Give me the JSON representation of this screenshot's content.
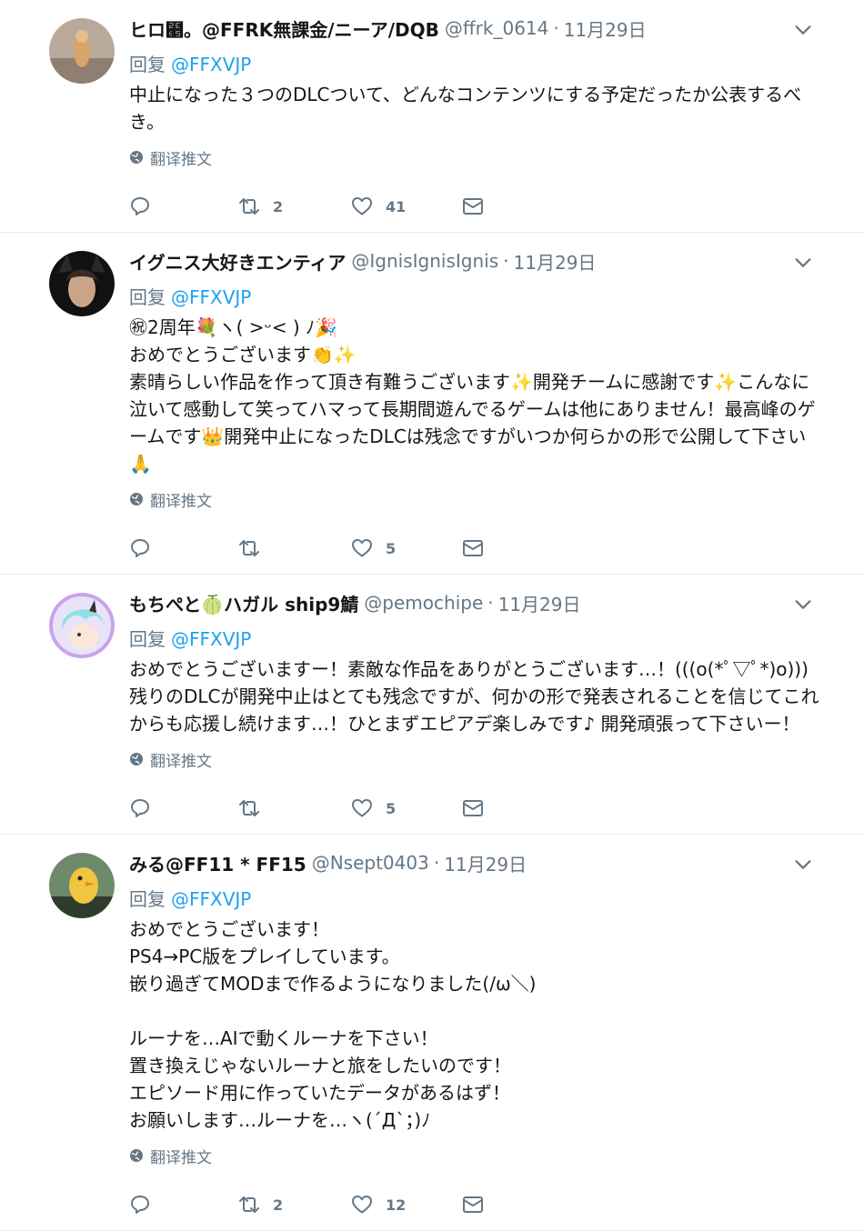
{
  "colors": {
    "link": "#1da1f2",
    "secondary": "#657786",
    "text": "#14171a",
    "divider": "#e6ecf0"
  },
  "icons": {
    "avatar_chevron": "chevron-down-icon",
    "reply": "reply-icon",
    "retweet": "retweet-icon",
    "like": "heart-icon",
    "message": "envelope-icon",
    "translate": "globe-icon"
  },
  "tweets": [
    {
      "name": "ヒロ⹥。@FFRK無課金/ニーア/DQB",
      "handle": "@ffrk_0614",
      "time": "11月29日",
      "reply_label": "回复",
      "reply_mention": "@FFXVJP",
      "text": "中止になった３つのDLCついて、どんなコンテンツにする予定だったか公表するべき。",
      "translate": "翻译推文",
      "retweets": "2",
      "likes": "41"
    },
    {
      "name": "イグニス大好きエンティア",
      "handle": "@IgnisIgnisIgnis",
      "time": "11月29日",
      "reply_label": "回复",
      "reply_mention": "@FFXVJP",
      "text": "㊗2周年💐ヽ( >ᵕ< ) ﾉ🎉\nおめでとうございます👏✨\n素晴らしい作品を作って頂き有難うございます✨開発チームに感謝です✨こんなに泣いて感動して笑ってハマって長期間遊んでるゲームは他にありません！最高峰のゲームです👑開発中止になったDLCは残念ですがいつか何らかの形で公開して下さい🙏",
      "translate": "翻译推文",
      "retweets": "",
      "likes": "5"
    },
    {
      "name": "もちぺと🍈ハガル ship9鯖",
      "handle": "@pemochipe",
      "time": "11月29日",
      "reply_label": "回复",
      "reply_mention": "@FFXVJP",
      "text": "おめでとうございますー！素敵な作品をありがとうございます…！(((o(*ﾟ▽ﾟ*)o))) 残りのDLCが開発中止はとても残念ですが、何かの形で発表されることを信じてこれからも応援し続けます…！ひとまずエピアデ楽しみです♪ 開発頑張って下さいー！",
      "translate": "翻译推文",
      "retweets": "",
      "likes": "5"
    },
    {
      "name": "みる@FF11 * FF15",
      "handle": "@Nsept0403",
      "time": "11月29日",
      "reply_label": "回复",
      "reply_mention": "@FFXVJP",
      "text": "おめでとうございます！\nPS4→PC版をプレイしています。\n嵌り過ぎてMODまで作るようになりました(/ω＼)\n\nルーナを…AIで動くルーナを下さい！\n置き換えじゃないルーナと旅をしたいのです！\nエピソード用に作っていたデータがあるはず！\nお願いします…ルーナを…ヽ(´Д`；)ﾉ",
      "translate": "翻译推文",
      "retweets": "2",
      "likes": "12"
    }
  ]
}
